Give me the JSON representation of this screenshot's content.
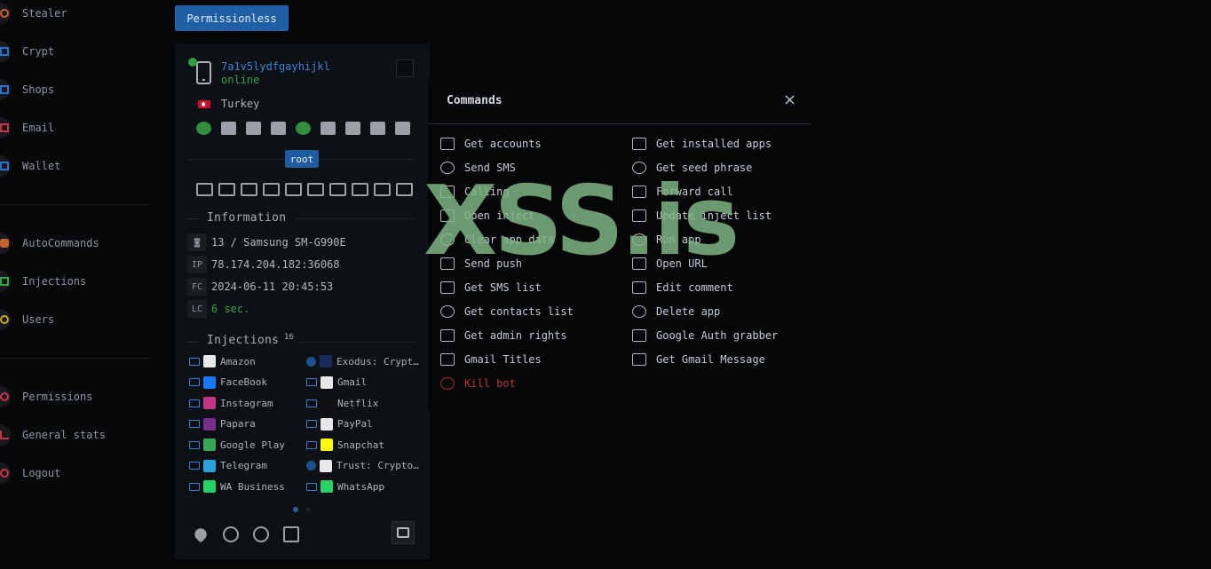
{
  "sidebar": {
    "items": [
      {
        "label": "Stealer",
        "icon": "target-icon",
        "color": "#c8622e"
      },
      {
        "label": "Crypt",
        "icon": "file-lock-icon",
        "color": "#2e6fc8"
      },
      {
        "label": "Shops",
        "icon": "shop-icon",
        "color": "#2e6fc8"
      },
      {
        "label": "Email",
        "icon": "mail-icon",
        "color": "#c8344a"
      },
      {
        "label": "Wallet",
        "icon": "wallet-icon",
        "color": "#2e6fc8"
      },
      {
        "label": "AutoCommands",
        "icon": "android-icon",
        "color": "#c8622e"
      },
      {
        "label": "Injections",
        "icon": "syringe-icon",
        "color": "#3aa345"
      },
      {
        "label": "Users",
        "icon": "user-icon",
        "color": "#c8a52e"
      },
      {
        "label": "Permissions",
        "icon": "key-icon",
        "color": "#c8344a"
      },
      {
        "label": "General stats",
        "icon": "chart-icon",
        "color": "#c8344a"
      },
      {
        "label": "Logout",
        "icon": "power-icon",
        "color": "#c8344a"
      }
    ]
  },
  "top_button": "Permissionless",
  "bot": {
    "id": "7a1v5lydfgayhijkl",
    "status": "online",
    "country": "Turkey",
    "root_label": "root",
    "info_title": "Information",
    "info": [
      {
        "tag": "◙",
        "value": "13 / Samsung SM-G990E"
      },
      {
        "tag": "IP",
        "value": "78.174.204.182:36068"
      },
      {
        "tag": "FC",
        "value": "2024-06-11 20:45:53"
      },
      {
        "tag": "LC",
        "value": "6 sec."
      }
    ],
    "injections_title": "Injections",
    "injections_count": "16",
    "injections": [
      {
        "name": "Amazon",
        "color": "#e8e8e8"
      },
      {
        "name": "Exodus: Crypt…",
        "color": "#1a2a5a"
      },
      {
        "name": "FaceBook",
        "color": "#1877f2"
      },
      {
        "name": "Gmail",
        "color": "#e8e8e8"
      },
      {
        "name": "Instagram",
        "color": "#c13584"
      },
      {
        "name": "Netflix",
        "color": "#111111"
      },
      {
        "name": "Papara",
        "color": "#7b2d8e"
      },
      {
        "name": "PayPal",
        "color": "#e8e8e8"
      },
      {
        "name": "Google Play",
        "color": "#34a853"
      },
      {
        "name": "Snapchat",
        "color": "#fffc00"
      },
      {
        "name": "Telegram",
        "color": "#2aa3dc"
      },
      {
        "name": "Trust: Crypto…",
        "color": "#e8e8e8"
      },
      {
        "name": "WA Business",
        "color": "#25d366"
      },
      {
        "name": "WhatsApp",
        "color": "#25d366"
      }
    ]
  },
  "modal": {
    "title": "Commands",
    "close": "×",
    "left": [
      "Get accounts",
      "Send SMS",
      "Calling",
      "Open inject",
      "Clear app data",
      "Send push",
      "Get SMS list",
      "Get contacts list",
      "Get admin rights",
      "Gmail Titles",
      "Kill bot"
    ],
    "right": [
      "Get installed apps",
      "Get seed phrase",
      "Forward call",
      "Update inject list",
      "Run app",
      "Open URL",
      "Edit comment",
      "Delete app",
      "Google Auth grabber",
      "Get Gmail Message"
    ]
  },
  "watermark": "XSS.is"
}
